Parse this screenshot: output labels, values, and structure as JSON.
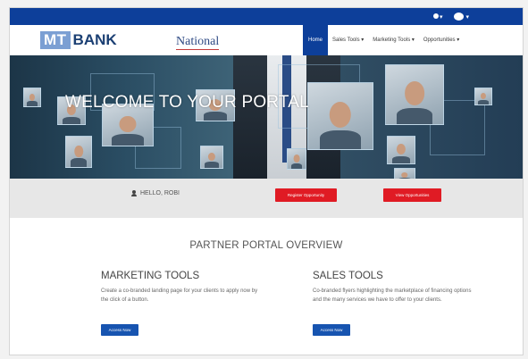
{
  "topbar": {
    "bg": "#0d3f9a",
    "user_caret": "▾",
    "account_caret": "▾"
  },
  "logo": {
    "mt": "MT",
    "bank": "BANK",
    "partner": "National"
  },
  "nav": {
    "items": [
      {
        "label": "Home",
        "active": true
      },
      {
        "label": "Sales Tools ▾",
        "active": false
      },
      {
        "label": "Marketing Tools ▾",
        "active": false
      },
      {
        "label": "Opportunities ▾",
        "active": false
      }
    ]
  },
  "hero": {
    "title": "WELCOME TO YOUR PORTAL"
  },
  "greeting": {
    "hello": "HELLO, ROBI",
    "register_button": "Register Opportunity",
    "view_button": "View Opportunities"
  },
  "overview": {
    "title": "PARTNER PORTAL OVERVIEW"
  },
  "marketing": {
    "title": "MARKETING TOOLS",
    "text": "Create a co-branded landing page for your clients to apply now by the click of a button.",
    "button": "Access Now"
  },
  "sales": {
    "title": "SALES TOOLS",
    "text": "Co-branded flyers highlighting the marketplace of financing options and the many services we have to offer to your clients.",
    "button": "Access Now"
  },
  "colors": {
    "brand_blue": "#0d3f9a",
    "action_red": "#e01b24",
    "button_blue": "#1754b0"
  }
}
